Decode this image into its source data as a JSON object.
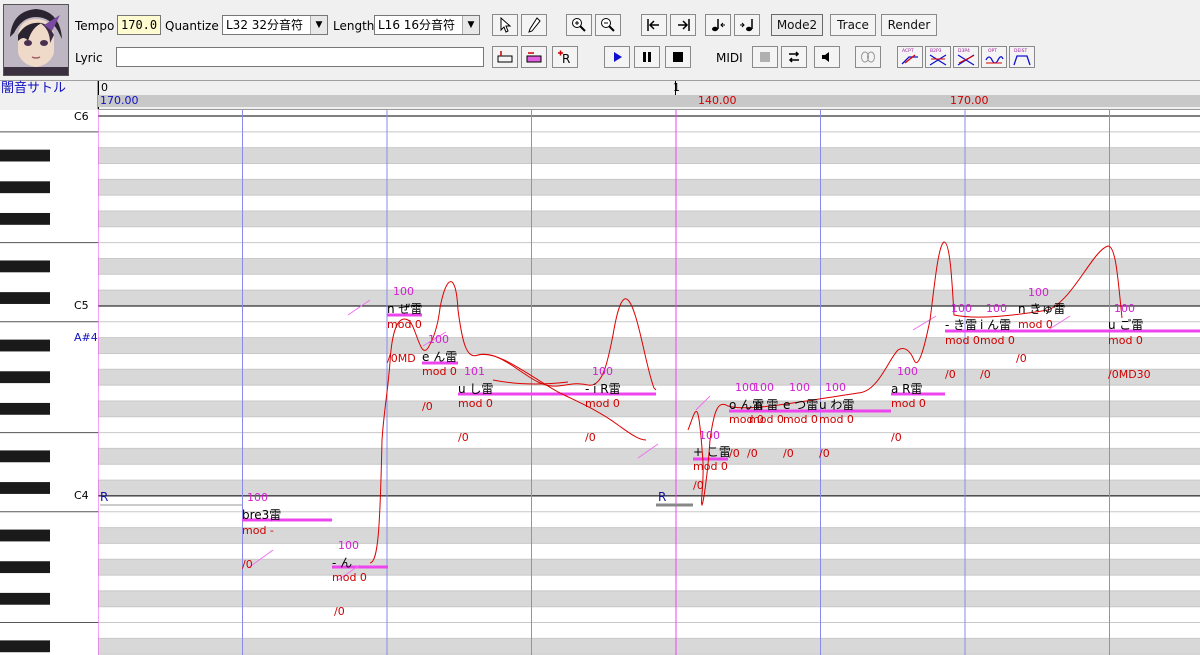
{
  "toolbar": {
    "tempo_label": "Tempo",
    "tempo_value": "170.0",
    "quantize_label": "Quantize",
    "quantize_value": "L32 32分音符",
    "length_label": "Length",
    "length_value": "L16 16分音符",
    "lyric_label": "Lyric",
    "lyric_value": "",
    "mode2_label": "Mode2",
    "trace_label": "Trace",
    "render_label": "Render",
    "midi_label": "MIDI",
    "small_icon_texts": [
      "ACPT",
      "B2P3",
      "D3P4",
      "OPT",
      "DEIST"
    ]
  },
  "track": {
    "singer_name": "闇音サトル",
    "measure_numbers": [
      "0",
      "1"
    ],
    "tempo_marks": [
      "170.00",
      "140.00",
      "170.00"
    ]
  },
  "keyboard": {
    "octave_labels": [
      "C6",
      "C5",
      "C4"
    ],
    "highlight_label": "A#4"
  },
  "notes": [
    {
      "lyric": "bre3雷",
      "velocity": "100",
      "mod": "mod -"
    },
    {
      "lyric": "- ん",
      "velocity": "100",
      "mod": "mod 0"
    },
    {
      "lyric": "n ぜ雷",
      "velocity": "100",
      "mod": "mod 0"
    },
    {
      "lyric": "e ん雷",
      "velocity": "100",
      "mod": "mod 0"
    },
    {
      "lyric": "u し雷",
      "velocity": "101",
      "mod": "mod 0"
    },
    {
      "lyric": "- i R雷",
      "velocity": "100",
      "mod": "mod 0"
    },
    {
      "lyric": "+ こ雷",
      "velocity": "100",
      "mod": "mod 0"
    },
    {
      "lyric": "o ん雷",
      "velocity": "100",
      "mod": "mod 0"
    },
    {
      "lyric": "n 雷",
      "velocity": "100",
      "mod": "mod 0"
    },
    {
      "lyric": "e つ雷",
      "velocity": "100",
      "mod": "mod 0"
    },
    {
      "lyric": "u わ雷",
      "velocity": "100",
      "mod": "mod 0"
    },
    {
      "lyric": "a R雷",
      "velocity": "100",
      "mod": "mod 0"
    },
    {
      "lyric": "- き雷",
      "velocity": "100",
      "mod": "mod 0"
    },
    {
      "lyric": "i ん雷",
      "velocity": "100",
      "mod": "mod 0"
    },
    {
      "lyric": "n きゅ雷",
      "velocity": "100",
      "mod": "mod 0"
    },
    {
      "lyric": "u ご雷",
      "velocity": "100",
      "mod": "mod 0"
    }
  ],
  "rest_marks": [
    "R",
    "R"
  ],
  "envelope_marks": [
    "/0",
    "/0",
    "/0MD",
    "/0",
    "/0",
    "/0",
    "/0",
    "/0",
    "/0",
    "/0",
    "/0",
    "/0",
    "/0",
    "/0",
    "/0",
    "/0MD30"
  ],
  "colors": {
    "note_bar": "#ee44ee",
    "pitch_line": "#dd0000",
    "velocity_text": "#d020d0",
    "grid_beat": "#8a8aee",
    "grid_bar": "#ee44ee",
    "tempo_text": "#cc0000"
  }
}
